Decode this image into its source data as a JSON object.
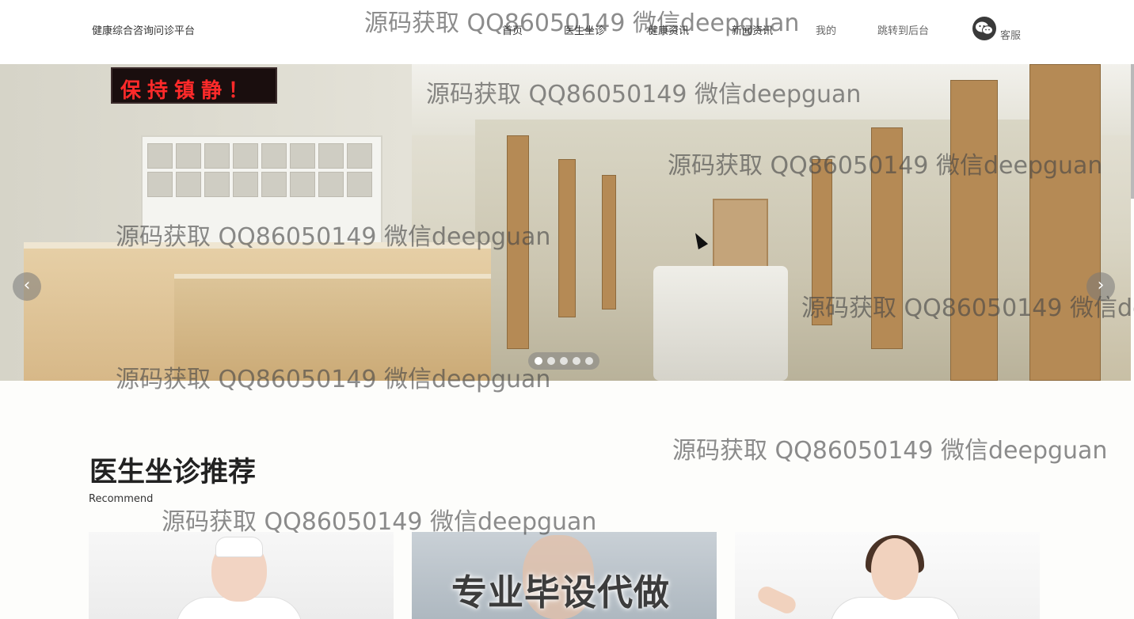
{
  "header": {
    "brand": "健康综合咨询问诊平台",
    "nav": [
      {
        "label": "首页"
      },
      {
        "label": "医生坐诊"
      },
      {
        "label": "健康资讯"
      },
      {
        "label": "新闻资讯"
      },
      {
        "label": "我的"
      },
      {
        "label": "跳转到后台"
      }
    ],
    "customer_service": {
      "label": "客服",
      "icon": "wechat-icon"
    }
  },
  "banner": {
    "sign_text": "保持镇静！",
    "prev_icon": "‹",
    "next_icon": "›",
    "slide_count": 5,
    "active_slide": 1
  },
  "section": {
    "title": "医生坐诊推荐",
    "subtitle": "Recommend"
  },
  "cards": [
    {
      "overlay": ""
    },
    {
      "overlay": "专业毕设代做"
    },
    {
      "overlay": ""
    }
  ],
  "watermark": "源码获取 QQ86050149 微信deepguan"
}
